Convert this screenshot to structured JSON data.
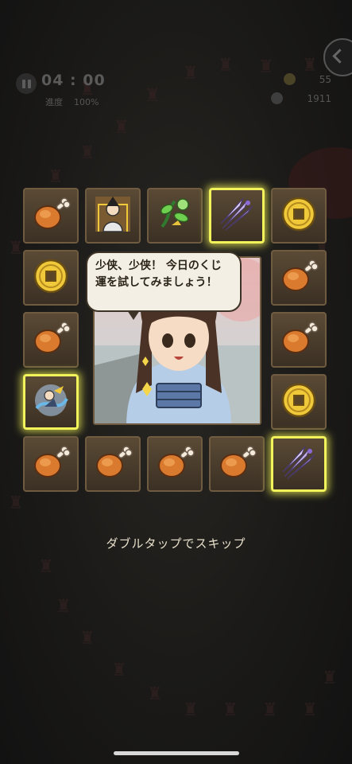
{
  "hud": {
    "timer": "04 : 00",
    "progress_label": "進度",
    "progress_value": "100%",
    "coins": "55",
    "gems": "1911"
  },
  "grid": {
    "tiles": [
      {
        "icon": "meat-icon",
        "highlighted": false
      },
      {
        "icon": "hero-portrait-icon",
        "highlighted": false
      },
      {
        "icon": "herb-icon",
        "highlighted": false
      },
      {
        "icon": "daggers-icon",
        "highlighted": true
      },
      {
        "icon": "coin-icon",
        "highlighted": false
      },
      {
        "icon": "coin-icon",
        "highlighted": false
      },
      {
        "icon": "meat-icon",
        "highlighted": false
      },
      {
        "icon": "meat-icon",
        "highlighted": false
      },
      {
        "icon": "meat-icon",
        "highlighted": false
      },
      {
        "icon": "spirit-skill-icon",
        "highlighted": true
      },
      {
        "icon": "coin-icon",
        "highlighted": false
      },
      {
        "icon": "meat-icon",
        "highlighted": false
      },
      {
        "icon": "meat-icon",
        "highlighted": false
      },
      {
        "icon": "meat-icon",
        "highlighted": false
      },
      {
        "icon": "meat-icon",
        "highlighted": false
      },
      {
        "icon": "daggers-icon",
        "highlighted": true
      }
    ]
  },
  "dialog": {
    "text": "少侠、少侠！ 今日のくじ運を試してみましょう！"
  },
  "skip_hint": "ダブルタップでスキップ",
  "colors": {
    "highlight": "#f2f25a",
    "tile_border": "#6e5b40",
    "background": "#1b1a18"
  }
}
